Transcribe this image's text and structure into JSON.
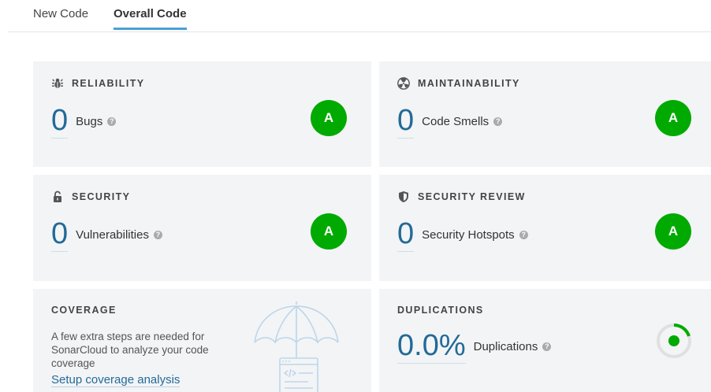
{
  "tabs": [
    {
      "label": "New Code"
    },
    {
      "label": "Overall Code",
      "active": true
    }
  ],
  "colors": {
    "rating_a": "#00aa00",
    "link": "#236a97",
    "tab_active": "#4b9fd5",
    "card_bg": "#f3f4f6"
  },
  "cards": {
    "reliability": {
      "title": "RELIABILITY",
      "icon": "bug-icon",
      "value": "0",
      "label": "Bugs",
      "rating": "A"
    },
    "maintainability": {
      "title": "MAINTAINABILITY",
      "icon": "radiation-icon",
      "value": "0",
      "label": "Code Smells",
      "rating": "A"
    },
    "security": {
      "title": "SECURITY",
      "icon": "lock-icon",
      "value": "0",
      "label": "Vulnerabilities",
      "rating": "A"
    },
    "security_review": {
      "title": "SECURITY REVIEW",
      "icon": "shield-icon",
      "value": "0",
      "label": "Security Hotspots",
      "rating": "A"
    },
    "coverage": {
      "title": "COVERAGE",
      "description": "A few extra steps are needed for SonarCloud to analyze your code coverage",
      "link": "Setup coverage analysis",
      "icon": "umbrella-code-icon"
    },
    "duplications": {
      "title": "DUPLICATIONS",
      "value": "0.0%",
      "label": "Duplications",
      "icon": "duplication-donut-icon",
      "fraction": 0.0
    }
  },
  "help_glyph": "?"
}
